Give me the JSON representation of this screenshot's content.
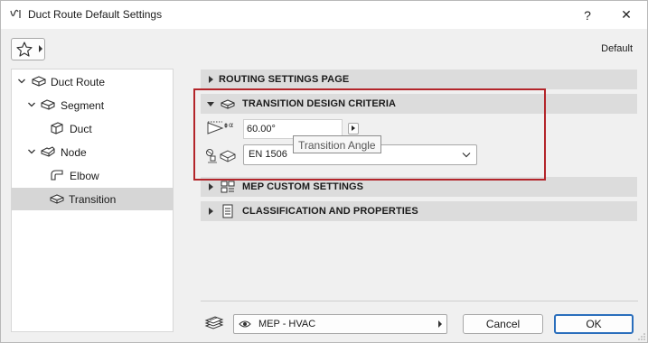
{
  "window": {
    "title": "Duct Route Default Settings",
    "help_glyph": "?",
    "close_glyph": "✕",
    "profile_label": "Default"
  },
  "tree": {
    "items": [
      {
        "label": "Duct Route",
        "icon": "duct-route-icon",
        "expanded": true
      },
      {
        "label": "Segment",
        "icon": "segment-icon",
        "expanded": true
      },
      {
        "label": "Duct",
        "icon": "duct-icon"
      },
      {
        "label": "Node",
        "icon": "node-icon",
        "expanded": true
      },
      {
        "label": "Elbow",
        "icon": "elbow-icon"
      },
      {
        "label": "Transition",
        "icon": "transition-icon",
        "selected": true
      }
    ]
  },
  "sections": {
    "routing": {
      "label": "ROUTING SETTINGS PAGE",
      "expanded": false
    },
    "transition": {
      "label": "TRANSITION DESIGN CRITERIA",
      "expanded": true
    },
    "mep_custom": {
      "label": "MEP CUSTOM SETTINGS",
      "expanded": false
    },
    "classification": {
      "label": "CLASSIFICATION AND PROPERTIES",
      "expanded": false
    }
  },
  "transition_params": {
    "angle_symbol": "α",
    "angle_value": "60.00°",
    "angle_tooltip": "Transition Angle",
    "standard_value": "EN 1506"
  },
  "footer": {
    "view_label": "MEP - HVAC",
    "cancel_label": "Cancel",
    "ok_label": "OK"
  },
  "colors": {
    "highlight": "#b3252a",
    "selected_row": "#d6d6d6",
    "section_header": "#dcdcdc",
    "ok_border": "#2a6ebc"
  }
}
